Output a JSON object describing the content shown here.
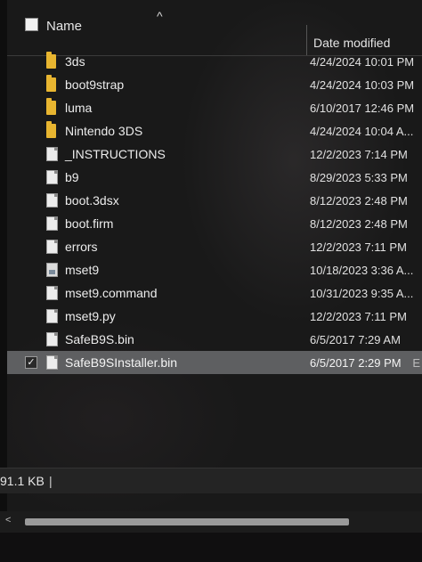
{
  "header": {
    "col_name": "Name",
    "col_date": "Date modified",
    "sort_glyph": "^"
  },
  "files": [
    {
      "name": "3ds",
      "date": "4/24/2024 10:01 PM",
      "icon": "folder-icon"
    },
    {
      "name": "boot9strap",
      "date": "4/24/2024 10:03 PM",
      "icon": "folder-icon"
    },
    {
      "name": "luma",
      "date": "6/10/2017 12:46 PM",
      "icon": "folder-icon"
    },
    {
      "name": "Nintendo 3DS",
      "date": "4/24/2024 10:04 A...",
      "icon": "folder-icon"
    },
    {
      "name": "_INSTRUCTIONS",
      "date": "12/2/2023 7:14 PM",
      "icon": "file-icon"
    },
    {
      "name": "b9",
      "date": "8/29/2023 5:33 PM",
      "icon": "file-icon"
    },
    {
      "name": "boot.3dsx",
      "date": "8/12/2023 2:48 PM",
      "icon": "file-icon"
    },
    {
      "name": "boot.firm",
      "date": "8/12/2023 2:48 PM",
      "icon": "file-icon"
    },
    {
      "name": "errors",
      "date": "12/2/2023 7:11 PM",
      "icon": "file-icon"
    },
    {
      "name": "mset9",
      "date": "10/18/2023 3:36 A...",
      "icon": "file-image-icon"
    },
    {
      "name": "mset9.command",
      "date": "10/31/2023 9:35 A...",
      "icon": "file-icon"
    },
    {
      "name": "mset9.py",
      "date": "12/2/2023 7:11 PM",
      "icon": "file-icon"
    },
    {
      "name": "SafeB9S.bin",
      "date": "6/5/2017 7:29 AM",
      "icon": "file-icon"
    },
    {
      "name": "SafeB9SInstaller.bin",
      "date": "6/5/2017 2:29 PM",
      "icon": "file-icon"
    }
  ],
  "selected_trail": "E",
  "status": {
    "size": "91.1 KB",
    "separator": "|"
  },
  "scrollbar": {
    "left_arrow": "<"
  },
  "colors": {
    "folder": "#e8b530",
    "selection": "#5e5f61",
    "background": "#191919"
  }
}
